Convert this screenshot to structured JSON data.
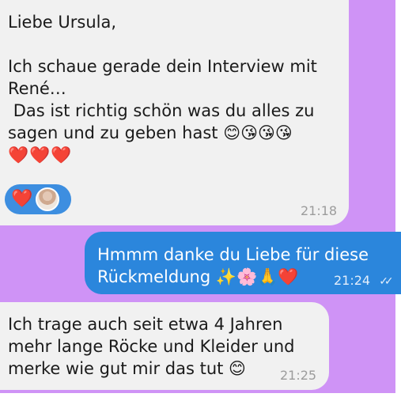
{
  "messages": [
    {
      "direction": "incoming",
      "lines": [
        "Liebe Ursula,",
        "",
        "Ich schaue gerade dein Interview mit",
        "René…",
        " Das ist richtig schön was du alles zu",
        "sagen und zu geben hast 😊😘😘😘"
      ],
      "emoji_line": "❤️❤️❤️",
      "reaction": {
        "emoji": "❤️",
        "reactor": "avatar"
      },
      "time": "21:18"
    },
    {
      "direction": "outgoing",
      "lines": [
        "Hmmm danke du Liebe für diese",
        "Rückmeldung ✨🌸🙏❤️"
      ],
      "time": "21:24",
      "status_icon": "double-check-icon"
    },
    {
      "direction": "incoming",
      "lines": [
        "Ich trage auch seit etwa 4 Jahren",
        "mehr lange Röcke und Kleider und",
        "merke wie gut mir das tut 😊"
      ],
      "time": "21:25"
    }
  ],
  "colors": {
    "chat_background": "#cf93f6",
    "incoming_bubble": "#f1f1f1",
    "outgoing_bubble": "#2b86dc"
  }
}
